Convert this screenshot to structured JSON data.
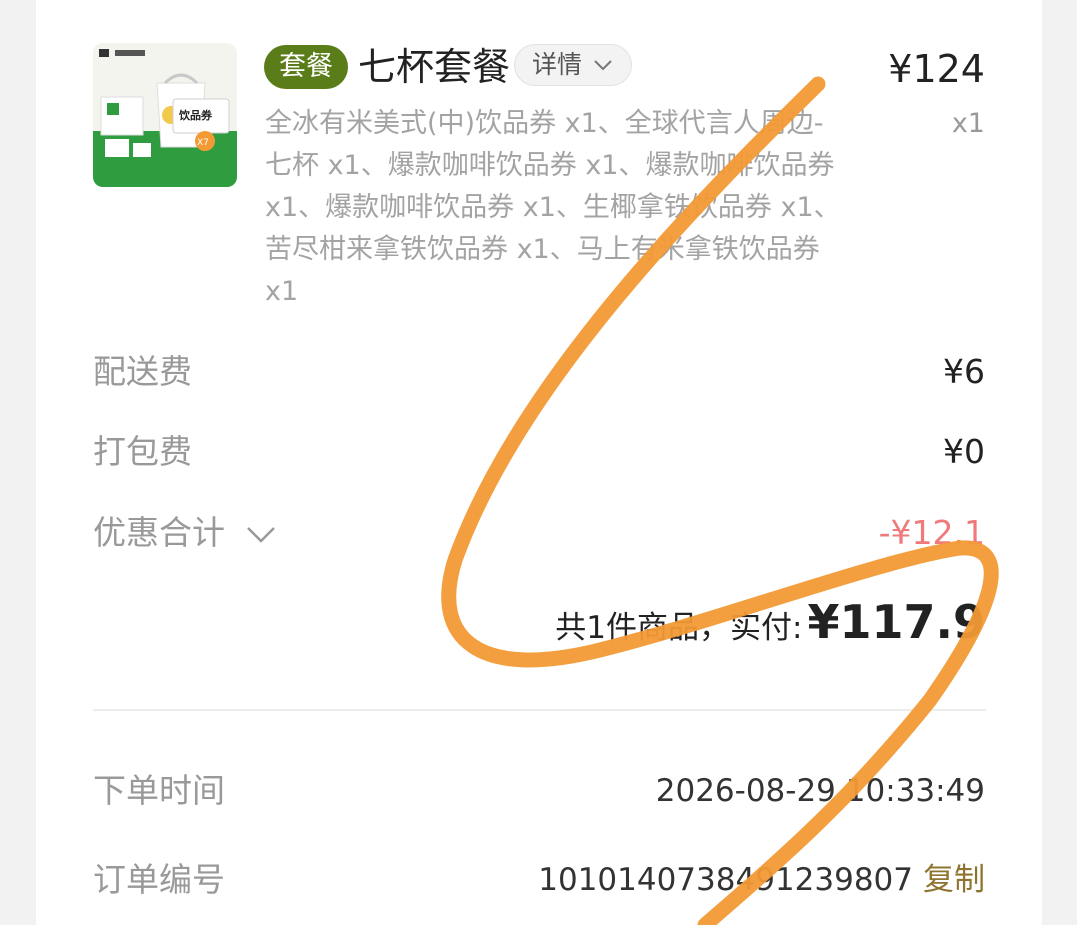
{
  "item": {
    "tag": "套餐",
    "title": "七杯套餐",
    "detail_label": "详情",
    "price": "¥124",
    "quantity": "x1",
    "description": "全冰有米美式(中)饮品券 x1、全球代言人周边-七杯 x1、爆款咖啡饮品券 x1、爆款咖啡饮品券 x1、爆款咖啡饮品券 x1、生椰拿铁饮品券 x1、苦尽柑来拿铁饮品券 x1、马上有米拿铁饮品券 x1",
    "thumbnail_text": "饮品券",
    "thumbnail_badge": "X7"
  },
  "fees": {
    "delivery_label": "配送费",
    "delivery_value": "¥6",
    "packing_label": "打包费",
    "packing_value": "¥0",
    "discount_label": "优惠合计",
    "discount_value": "-¥12.1"
  },
  "total": {
    "label": "共1件商品，实付:",
    "amount": "¥117.9"
  },
  "order": {
    "time_label": "下单时间",
    "time_value": "2026-08-29 10:33:49",
    "number_label": "订单编号",
    "number_value": "1010140738491239807",
    "copy_label": "复制"
  },
  "colors": {
    "tag_bg": "#5a7d1a",
    "discount": "#f07a7a",
    "copy_link": "#8f7430",
    "scribble": "#f39a35"
  },
  "icons": [
    "chevron-down-icon",
    "product-thumbnail"
  ]
}
